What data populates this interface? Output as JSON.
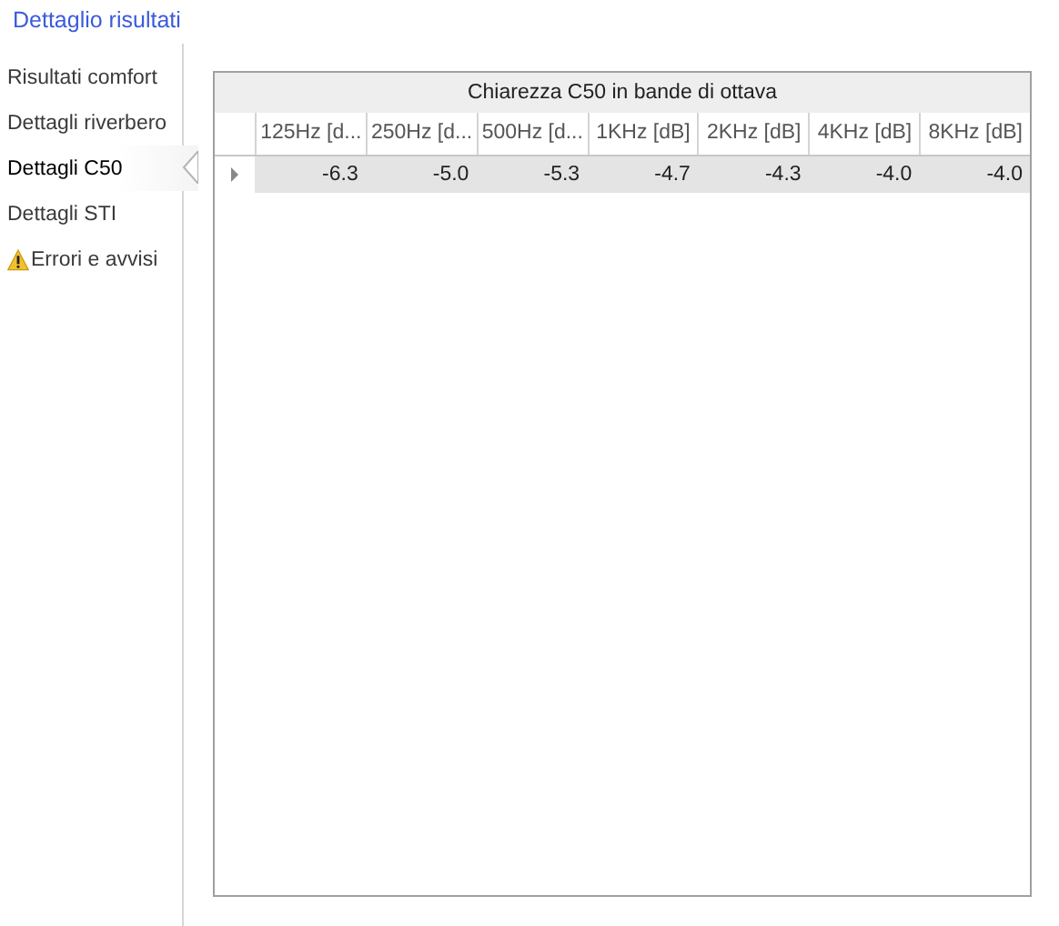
{
  "title": "Dettaglio risultati",
  "sidebar": {
    "items": [
      {
        "label": "Risultati comfort",
        "selected": false,
        "kind": "plain"
      },
      {
        "label": "Dettagli riverbero",
        "selected": false,
        "kind": "plain"
      },
      {
        "label": "Dettagli C50",
        "selected": true,
        "kind": "plain"
      },
      {
        "label": "Dettagli STI",
        "selected": false,
        "kind": "plain"
      },
      {
        "label": "Errori e avvisi",
        "selected": false,
        "kind": "warning"
      }
    ]
  },
  "table": {
    "band": "Chiarezza C50 in bande di ottava",
    "columns": [
      "125Hz [d...",
      "250Hz [d...",
      "500Hz [d...",
      "1KHz [dB]",
      "2KHz [dB]",
      "4KHz [dB]",
      "8KHz [dB]"
    ],
    "rows": [
      {
        "selected": true,
        "cells": [
          "-6.3",
          "-5.0",
          "-5.3",
          "-4.7",
          "-4.3",
          "-4.0",
          "-4.0"
        ]
      }
    ]
  }
}
